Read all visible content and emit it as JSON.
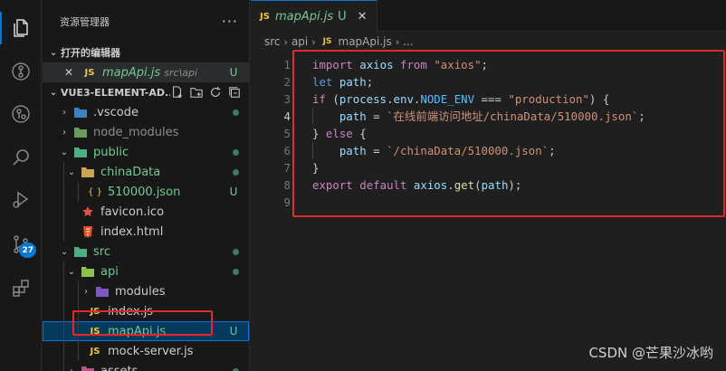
{
  "activity_bar": {
    "items": [
      {
        "icon": "explorer-icon",
        "active": true
      },
      {
        "icon": "timeline-icon"
      },
      {
        "icon": "git-lens-icon"
      },
      {
        "icon": "search-icon"
      },
      {
        "icon": "run-debug-icon"
      },
      {
        "icon": "source-control-icon",
        "badge": "27"
      },
      {
        "icon": "extensions-icon"
      }
    ]
  },
  "sidebar": {
    "title": "资源管理器",
    "more": "···",
    "open_editors": {
      "label": "打开的编辑器",
      "items": [
        {
          "close": "✕",
          "icon_text": "JS",
          "name": "mapApi.js",
          "path": "src\\api",
          "status": "U"
        }
      ]
    },
    "project": {
      "label": "VUE3-ELEMENT-AD...",
      "tree": [
        {
          "name": ".vscode",
          "chevron": "›"
        },
        {
          "name": "node_modules",
          "chevron": "›"
        },
        {
          "name": "public",
          "chevron": "⌄"
        },
        {
          "name": "chinaData",
          "chevron": "⌄"
        },
        {
          "name": "510000.json",
          "icon_text": "{ }",
          "status": "U"
        },
        {
          "name": "favicon.ico"
        },
        {
          "name": "index.html"
        },
        {
          "name": "src",
          "chevron": "⌄"
        },
        {
          "name": "api",
          "chevron": "⌄"
        },
        {
          "name": "modules",
          "chevron": "›"
        },
        {
          "name": "index.js",
          "icon_text": "JS"
        },
        {
          "name": "mapApi.js",
          "icon_text": "JS",
          "status": "U"
        },
        {
          "name": "mock-server.js",
          "icon_text": "JS"
        },
        {
          "name": "assets",
          "chevron": "›"
        }
      ]
    }
  },
  "editor": {
    "tab": {
      "icon_text": "JS",
      "name": "mapApi.js",
      "status": "U",
      "close": "✕"
    },
    "breadcrumb": [
      "src",
      "api",
      "mapApi.js",
      "..."
    ],
    "breadcrumb_js": "JS",
    "lines": {
      "n1": "1",
      "n2": "2",
      "n3": "3",
      "n4": "4",
      "n5": "5",
      "n6": "6",
      "n7": "7",
      "n8": "8",
      "n9": "9",
      "l1_import": "import",
      "l1_axios": "axios",
      "l1_from": "from",
      "l1_str": "\"axios\"",
      "l1_semi": ";",
      "l2_let": "let",
      "l2_path": "path",
      "l2_semi": ";",
      "l3_if": "if",
      "l3_open": " (",
      "l3_process": "process",
      "l3_dot1": ".",
      "l3_env": "env",
      "l3_dot2": ".",
      "l3_node_env": "NODE_ENV",
      "l3_eq": " === ",
      "l3_str": "\"production\"",
      "l3_close": ") {",
      "l4_path": "path",
      "l4_eq": " = ",
      "l4_str": "`在线前端访问地址/chinaData/510000.json`",
      "l4_semi": ";",
      "l5_close": "} ",
      "l5_else": "else",
      "l5_open": " {",
      "l6_path": "path",
      "l6_eq": " = ",
      "l6_str": "`/chinaData/510000.json`",
      "l6_semi": ";",
      "l7_close": "}",
      "l8_export": "export",
      "l8_default": "default",
      "l8_axios": "axios",
      "l8_dot": ".",
      "l8_get": "get",
      "l8_open": "(",
      "l8_path": "path",
      "l8_close": ");"
    }
  },
  "watermark": "CSDN @芒果沙冰哟",
  "colors": {
    "highlight": "#e02a2a",
    "accent": "#0078d4",
    "untracked": "#73c991",
    "js_icon": "#e8c840"
  }
}
